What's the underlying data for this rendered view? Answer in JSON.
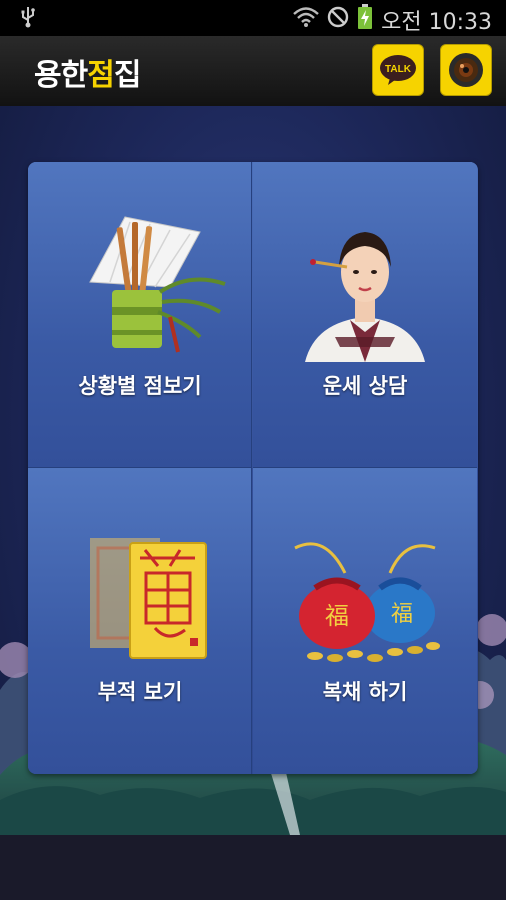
{
  "status_bar": {
    "time": "오전 10:33",
    "icons": [
      "usb-icon",
      "wifi-icon",
      "no-disturb-icon",
      "battery-charging-icon"
    ]
  },
  "app_bar": {
    "logo_text_a": "용한",
    "logo_text_b": "점",
    "logo_text_c": "집",
    "talk_button_label": "TALK",
    "camera_button_icon": "camera-lens-icon",
    "accent_color": "#f6d300"
  },
  "menu": {
    "items": [
      {
        "label": "상황별 점보기",
        "icon": "bamboo-fan-icon"
      },
      {
        "label": "운세 상담",
        "icon": "hanbok-woman-icon"
      },
      {
        "label": "부적 보기",
        "icon": "talisman-icon"
      },
      {
        "label": "복채 하기",
        "icon": "lucky-pouch-icon"
      }
    ],
    "tile_color": "#4a6db8"
  }
}
